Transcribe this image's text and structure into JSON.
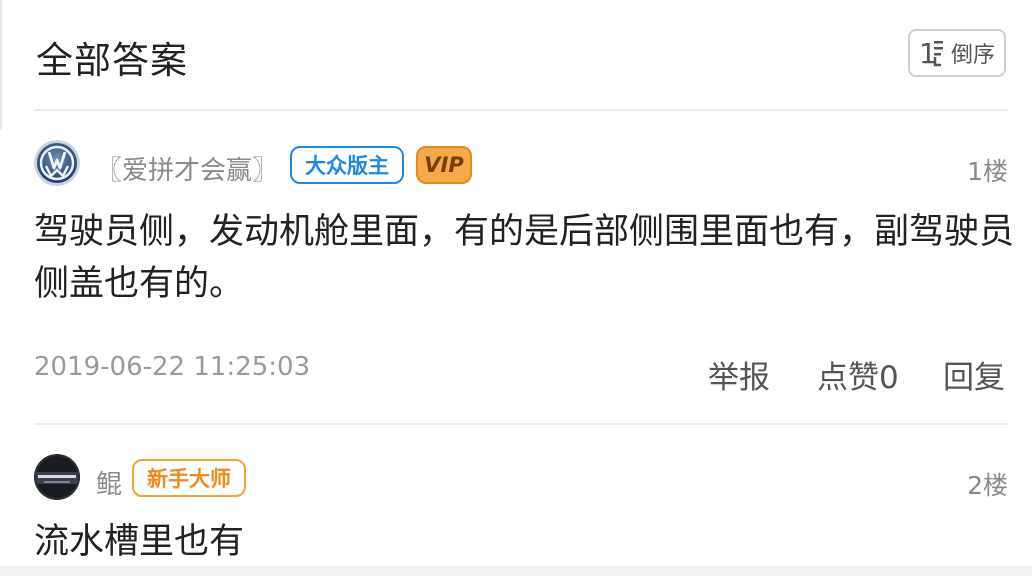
{
  "header": {
    "title": "全部答案",
    "sort_label": "倒序"
  },
  "posts": [
    {
      "username": "〖爱拼才会赢〗",
      "badges": [
        "大众版主",
        "VIP"
      ],
      "floor": "1楼",
      "content": "驾驶员侧，发动机舱里面，有的是后部侧围里面也有，副驾驶员侧盖也有的。",
      "timestamp": "2019-06-22 11:25:03",
      "actions": {
        "report": "举报",
        "like": "点赞0",
        "reply": "回复"
      },
      "avatar_icon": "volkswagen-logo"
    },
    {
      "username": "鲲",
      "badges": [
        "新手大师"
      ],
      "floor": "2楼",
      "content": "流水槽里也有",
      "avatar_icon": "car-front-photo"
    }
  ],
  "colors": {
    "accent_blue": "#1e88e5",
    "vip_orange": "#f4a94a",
    "badge_orange": "#f08a1c",
    "text_gray": "#8a8a8a"
  }
}
